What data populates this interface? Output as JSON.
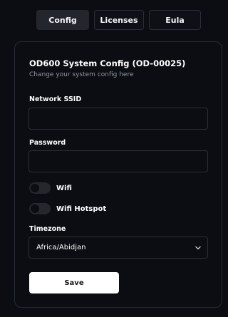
{
  "tabs": {
    "config": "Config",
    "licenses": "Licenses",
    "eula": "Eula"
  },
  "card": {
    "title": "OD600 System Config (OD-00025)",
    "subtitle": "Change your system config here"
  },
  "form": {
    "ssid_label": "Network SSID",
    "ssid_value": "",
    "password_label": "Password",
    "password_value": "",
    "wifi_label": "Wifi",
    "wifi_enabled": false,
    "hotspot_label": "Wifi Hotspot",
    "hotspot_enabled": false,
    "timezone_label": "Timezone",
    "timezone_value": "Africa/Abidjan",
    "save_label": "Save"
  },
  "colors": {
    "background": "#0b0d12",
    "active_tab": "#24262d",
    "border": "#2a2e37",
    "muted_text": "#8e96a3",
    "button": "#ffffff"
  }
}
